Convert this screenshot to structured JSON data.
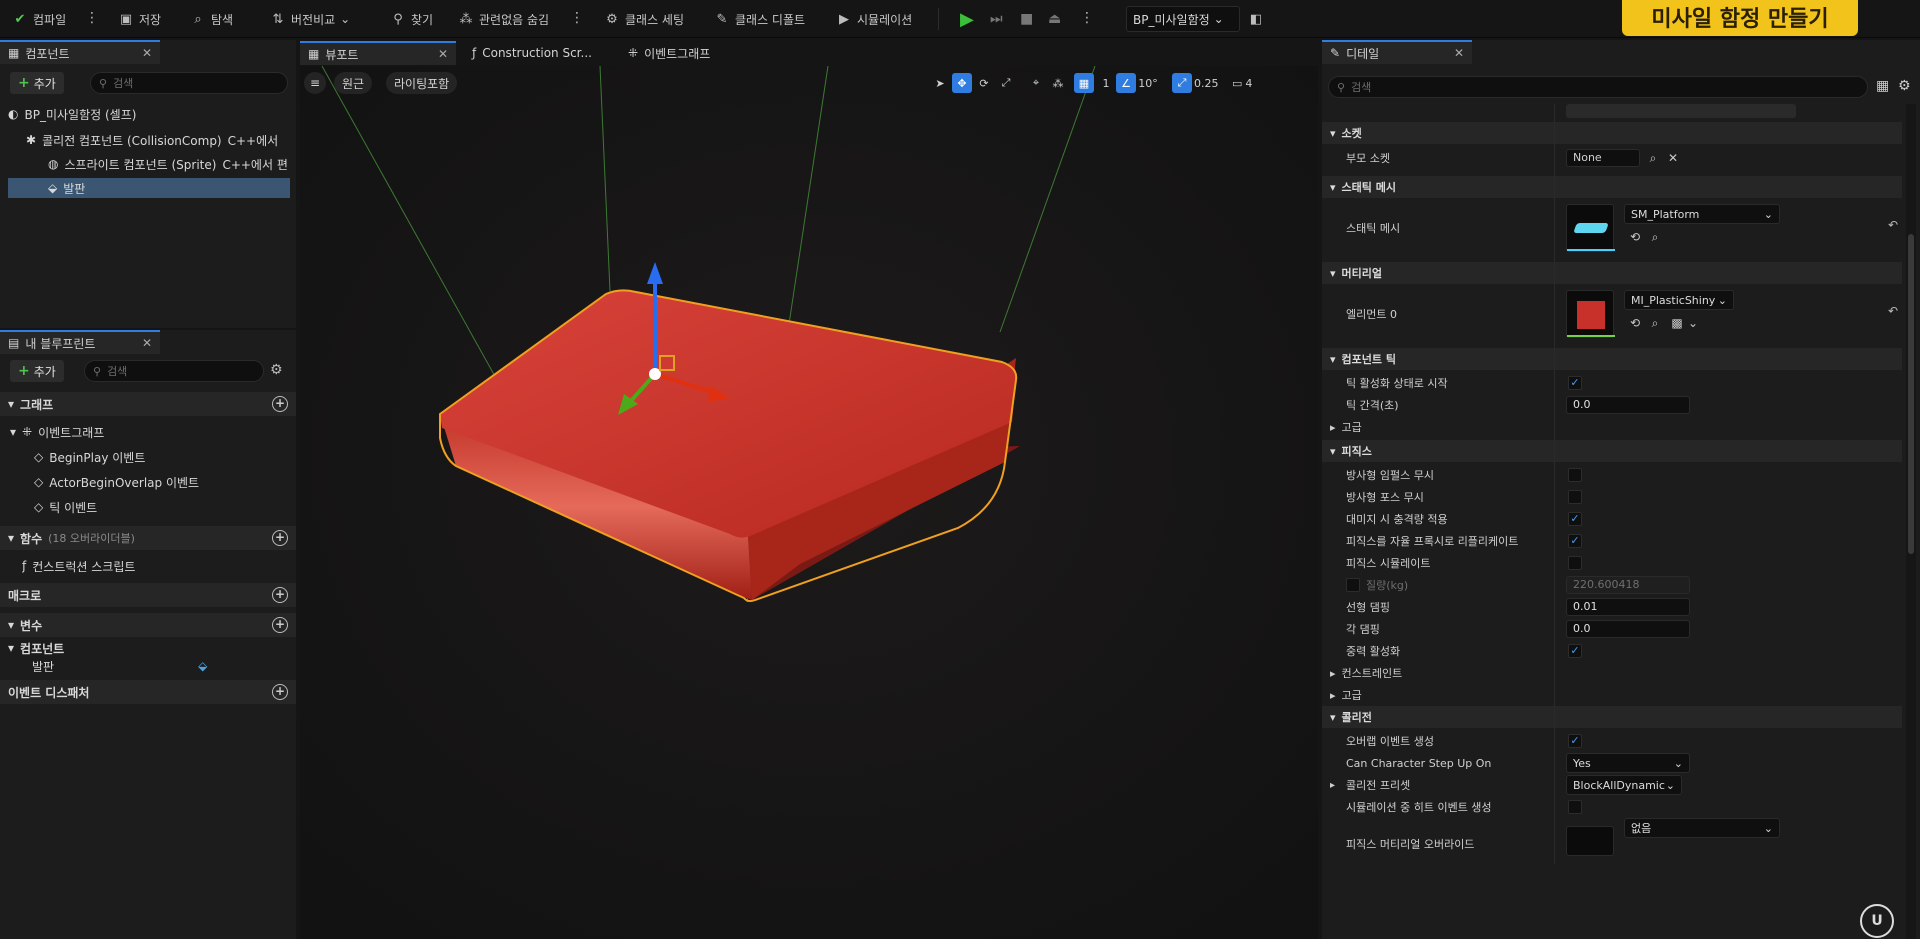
{
  "toolbar": {
    "compile": "컴파일",
    "save": "저장",
    "browse": "탐색",
    "diff": "버전비교",
    "find": "찾기",
    "hide_unrelated": "관련없음 숨김",
    "class_settings": "클래스 세팅",
    "class_defaults": "클래스 디폴트",
    "simulation": "시뮬레이션",
    "blueprint_name": "BP_미사일함정"
  },
  "banner": {
    "text": "미사일 함정 만들기"
  },
  "components_panel": {
    "tab": "컴포넌트",
    "add": "추가",
    "search_placeholder": "검색",
    "items": [
      {
        "label": "BP_미사일함정 (셀프)",
        "suffix": ""
      },
      {
        "label": "콜리전 컴포넌트 (CollisionComp)",
        "suffix": "C++에서"
      },
      {
        "label": "스프라이트 컴포넌트 (Sprite)",
        "suffix": "C++에서 편"
      },
      {
        "label": "발판",
        "suffix": ""
      }
    ]
  },
  "my_blueprint": {
    "tab": "내 블루프린트",
    "add": "추가",
    "search_placeholder": "검색",
    "graphs": "그래프",
    "event_graph": "이벤트그래프",
    "events": [
      "BeginPlay 이벤트",
      "ActorBeginOverlap 이벤트",
      "틱 이벤트"
    ],
    "functions": "함수",
    "functions_sub": "(18 오버라이더블)",
    "construction_script": "컨스트럭션 스크립트",
    "macros": "매크로",
    "variables": "변수",
    "components_group": "컴포넌트",
    "component_var": "발판",
    "event_dispatchers": "이벤트 디스패처"
  },
  "editor_tabs": {
    "viewport": "뷰포트",
    "construction": "Construction Scr...",
    "event_graph": "이벤트그래프"
  },
  "viewport": {
    "perspective": "원근",
    "lighting": "라이팅포함",
    "grid_size": "1",
    "rotation_snap": "10°",
    "scale_snap": "0.25",
    "camera_speed": "4"
  },
  "details": {
    "tab": "디테일",
    "search_placeholder": "검색",
    "socket_cat": "소켓",
    "parent_socket_label": "부모 소켓",
    "parent_socket_value": "None",
    "static_mesh_cat": "스태틱 메시",
    "static_mesh_label": "스태틱 메시",
    "static_mesh_value": "SM_Platform",
    "materials_cat": "머티리얼",
    "element0_label": "엘리먼트 0",
    "element0_value": "MI_PlasticShiny",
    "tick_cat": "컴포넌트 틱",
    "tick_start_label": "틱 활성화 상태로 시작",
    "tick_interval_label": "틱 간격(초)",
    "tick_interval_value": "0.0",
    "advanced1": "고급",
    "physics_cat": "피직스",
    "ignore_radial_impulse": "방사형 임펄스 무시",
    "ignore_radial_force": "방사형 포스 무시",
    "apply_impulse_damage": "대미지 시 충격량 적용",
    "replicate_physics": "피직스를 자율 프록시로 리플리케이트",
    "simulate_physics": "피직스 시뮬레이트",
    "mass_label": "질량(kg)",
    "mass_value": "220.600418",
    "linear_damping_label": "선형 댐핑",
    "linear_damping_value": "0.01",
    "angular_damping_label": "각 댐핑",
    "angular_damping_value": "0.0",
    "enable_gravity": "중력 활성화",
    "constraints": "컨스트레인트",
    "advanced2": "고급",
    "collision_cat": "콜리전",
    "generate_overlap": "오버랩 이벤트 생성",
    "can_step_up_label": "Can Character Step Up On",
    "can_step_up_value": "Yes",
    "collision_presets_label": "콜리전 프리셋",
    "collision_presets_value": "BlockAllDynamic",
    "sim_hit_events": "시뮬레이션 중 히트 이벤트 생성",
    "phys_material_override": "피직스 머티리얼 오버라이드",
    "phys_material_value": "없음"
  },
  "colors": {
    "accent": "#2f7de0",
    "platform": "#c8302a",
    "outline": "#f0a020",
    "banner": "#f2c31a"
  }
}
